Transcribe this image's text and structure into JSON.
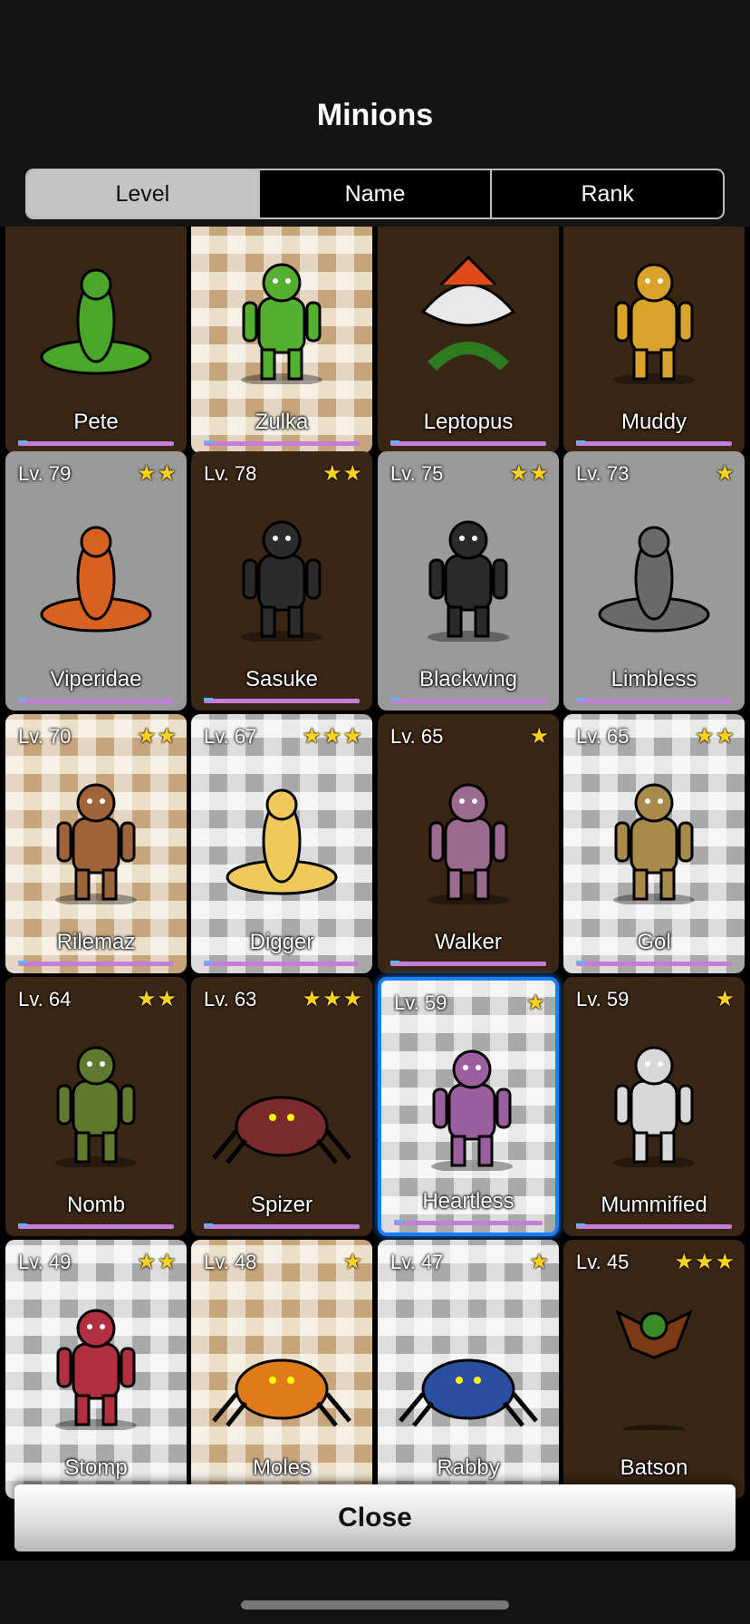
{
  "header": {
    "title": "Minions"
  },
  "sort_tabs": [
    {
      "label": "Level",
      "active": true
    },
    {
      "label": "Name",
      "active": false
    },
    {
      "label": "Rank",
      "active": false
    }
  ],
  "minions": [
    {
      "name": "Pete",
      "level": "",
      "stars": "",
      "bg": "brown",
      "icon": "lizard-icon",
      "color": "#4aa52a"
    },
    {
      "name": "Zulka",
      "level": "",
      "stars": "",
      "bg": "gold",
      "icon": "orc-warrior-icon",
      "color": "#55b030"
    },
    {
      "name": "Leptopus",
      "level": "",
      "stars": "",
      "bg": "brown",
      "icon": "carnivorous-plant-icon",
      "color": "#e04a1a"
    },
    {
      "name": "Muddy",
      "level": "",
      "stars": "",
      "bg": "brown",
      "icon": "mud-monster-icon",
      "color": "#d9a22a"
    },
    {
      "name": "Viperidae",
      "level": "Lv. 79",
      "stars": "★★",
      "bg": "gray",
      "icon": "cobra-icon",
      "color": "#d7621f"
    },
    {
      "name": "Sasuke",
      "level": "Lv. 78",
      "stars": "★★",
      "bg": "brown",
      "icon": "ninja-icon",
      "color": "#2b2b2b"
    },
    {
      "name": "Blackwing",
      "level": "Lv. 75",
      "stars": "★★",
      "bg": "gray",
      "icon": "vulture-icon",
      "color": "#2a2a2a"
    },
    {
      "name": "Limbless",
      "level": "Lv. 73",
      "stars": "★",
      "bg": "gray",
      "icon": "worm-icon",
      "color": "#6a6a6a"
    },
    {
      "name": "Rilemaz",
      "level": "Lv. 70",
      "stars": "★★",
      "bg": "gold",
      "icon": "goblin-icon",
      "color": "#a0643a"
    },
    {
      "name": "Digger",
      "level": "Lv. 67",
      "stars": "★★★",
      "bg": "silver",
      "icon": "grub-icon",
      "color": "#f0c95a"
    },
    {
      "name": "Walker",
      "level": "Lv. 65",
      "stars": "★",
      "bg": "brown",
      "icon": "zombie-icon",
      "color": "#9a6b8e"
    },
    {
      "name": "Gol",
      "level": "Lv. 65",
      "stars": "★★",
      "bg": "silver",
      "icon": "golem-icon",
      "color": "#a88a4a"
    },
    {
      "name": "Nomb",
      "level": "Lv. 64",
      "stars": "★★",
      "bg": "brown",
      "icon": "ogre-icon",
      "color": "#5d7a2e"
    },
    {
      "name": "Spizer",
      "level": "Lv. 63",
      "stars": "★★★",
      "bg": "brown",
      "icon": "spider-icon",
      "color": "#7a2a2a"
    },
    {
      "name": "Heartless",
      "level": "Lv. 59",
      "stars": "★",
      "bg": "silver",
      "icon": "zombie-icon",
      "color": "#9b5fa0",
      "selected": true
    },
    {
      "name": "Mummified",
      "level": "Lv. 59",
      "stars": "★",
      "bg": "brown",
      "icon": "mummy-icon",
      "color": "#d8d8d8"
    },
    {
      "name": "Stomp",
      "level": "Lv. 49",
      "stars": "★★",
      "bg": "silver",
      "icon": "bird-creature-icon",
      "color": "#b03040"
    },
    {
      "name": "Moles",
      "level": "Lv. 48",
      "stars": "★",
      "bg": "gold",
      "icon": "mole-icon",
      "color": "#e07a1a"
    },
    {
      "name": "Rabby",
      "level": "Lv. 47",
      "stars": "★",
      "bg": "silver",
      "icon": "crab-icon",
      "color": "#2a4ea0"
    },
    {
      "name": "Batson",
      "level": "Lv. 45",
      "stars": "★★★",
      "bg": "brown",
      "icon": "bat-icon",
      "color": "#3a8a2a"
    }
  ],
  "footer": {
    "close_label": "Close"
  }
}
